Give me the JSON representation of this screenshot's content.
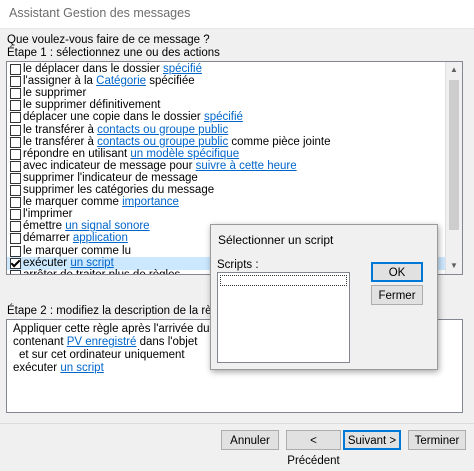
{
  "window": {
    "title": "Assistant Gestion des messages"
  },
  "prompt": "Que voulez-vous faire de ce message ?",
  "step1": {
    "label": "Étape 1 : sélectionnez une ou des actions"
  },
  "actions": [
    {
      "before": "le déplacer dans le dossier ",
      "link": "spécifié",
      "after": "",
      "checked": false
    },
    {
      "before": "l'assigner à la ",
      "link": "Catégorie",
      "after": " spécifiée",
      "checked": false
    },
    {
      "before": "le supprimer",
      "link": "",
      "after": "",
      "checked": false
    },
    {
      "before": "le supprimer définitivement",
      "link": "",
      "after": "",
      "checked": false
    },
    {
      "before": "déplacer une copie dans le dossier ",
      "link": "spécifié",
      "after": "",
      "checked": false
    },
    {
      "before": "le transférer à ",
      "link": "contacts ou groupe public",
      "after": "",
      "checked": false
    },
    {
      "before": "le transférer à ",
      "link": "contacts ou groupe public",
      "after": " comme pièce jointe",
      "checked": false
    },
    {
      "before": "répondre en utilisant ",
      "link": "un modèle spécifique",
      "after": "",
      "checked": false
    },
    {
      "before": "avec indicateur de message pour ",
      "link": "suivre à cette heure",
      "after": "",
      "checked": false
    },
    {
      "before": "supprimer l'indicateur de message",
      "link": "",
      "after": "",
      "checked": false
    },
    {
      "before": "supprimer les catégories du message",
      "link": "",
      "after": "",
      "checked": false
    },
    {
      "before": "le marquer comme ",
      "link": "importance",
      "after": "",
      "checked": false
    },
    {
      "before": "l'imprimer",
      "link": "",
      "after": "",
      "checked": false
    },
    {
      "before": "émettre ",
      "link": "un signal sonore",
      "after": "",
      "checked": false
    },
    {
      "before": "démarrer ",
      "link": "application",
      "after": "",
      "checked": false
    },
    {
      "before": "le marquer comme lu",
      "link": "",
      "after": "",
      "checked": false
    },
    {
      "before": "exécuter ",
      "link": "un script",
      "after": "",
      "checked": true
    },
    {
      "before": "arrêter de traiter plus de règles",
      "link": "",
      "after": "",
      "checked": false
    }
  ],
  "step2": {
    "label": "Étape 2 : modifiez la description de la règle (cliquez s"
  },
  "description": {
    "line1": "Appliquer cette règle après l'arrivée du message",
    "line2_before": "contenant ",
    "line2_link": "PV enregistré",
    "line2_after": " dans l'objet",
    "line3": "et sur cet ordinateur uniquement",
    "line4_before": "exécuter ",
    "line4_link": "un script"
  },
  "buttons": {
    "cancel": "Annuler",
    "back": "< Précédent",
    "next": "Suivant >",
    "finish": "Terminer"
  },
  "dialog": {
    "title": "Sélectionner un script",
    "scripts_label": "Scripts :",
    "ok": "OK",
    "close": "Fermer"
  },
  "colors": {
    "link": "#0066cc",
    "selection": "#cce8ff",
    "focus": "#0078d7"
  }
}
